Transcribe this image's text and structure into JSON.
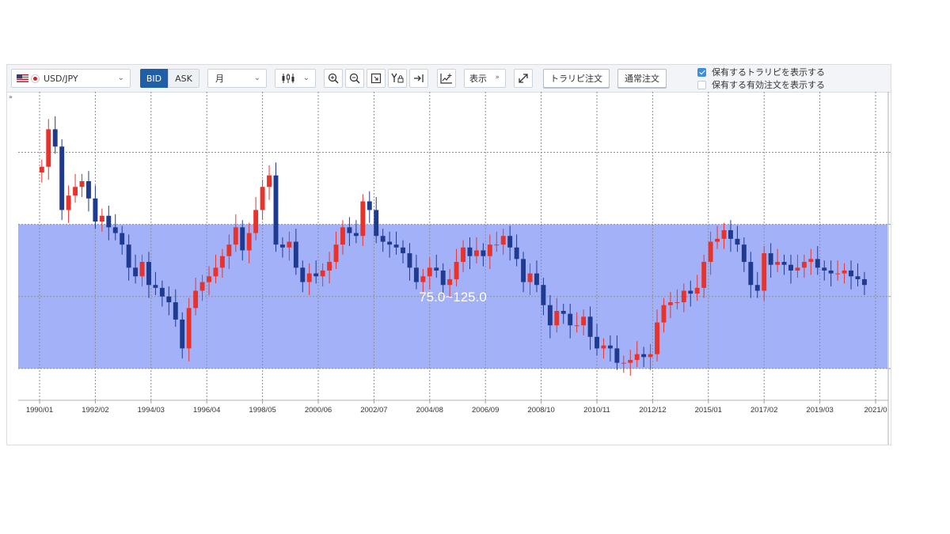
{
  "toolbar": {
    "symbol": "USD/JPY",
    "bid_label": "BID",
    "ask_label": "ASK",
    "period": "月",
    "display_label": "表示",
    "trailing_order_label": "トラリピ注文",
    "normal_order_label": "通常注文",
    "icons": [
      "chart-type-icon",
      "zoom-in-icon",
      "zoom-out-icon",
      "fit-icon",
      "y-lock-icon",
      "scroll-end-icon",
      "add-indicator-icon",
      "fullscreen-icon"
    ],
    "show_trailing_label": "保有するトラリピを表示する",
    "show_trailing_checked": true,
    "show_orders_label": "保有する有効注文を表示する",
    "show_orders_checked": false
  },
  "chart_data": {
    "type": "candlestick",
    "range_label": "75.0~125.0",
    "range": [
      75.0,
      125.0
    ],
    "range_color": "#a3b2f8",
    "up_color": "#e8332d",
    "down_color": "#1f3b8f",
    "ylim": [
      64,
      171
    ],
    "y_ticks": [
      "150.000",
      "125.000",
      "100.000",
      "75.000"
    ],
    "x_ticks": [
      "1990/01",
      "1992/02",
      "1994/03",
      "1996/04",
      "1998/05",
      "2000/06",
      "2002/07",
      "2004/08",
      "2006/09",
      "2008/10",
      "2010/11",
      "2012/12",
      "2015/01",
      "2017/02",
      "2019/03",
      "2021/0"
    ],
    "grid": true,
    "x": [
      "1990/01",
      "1990/04",
      "1990/07",
      "1990/10",
      "1991/01",
      "1991/04",
      "1991/07",
      "1991/10",
      "1992/01",
      "1992/04",
      "1992/07",
      "1992/10",
      "1993/01",
      "1993/04",
      "1993/07",
      "1993/10",
      "1994/01",
      "1994/04",
      "1994/07",
      "1994/10",
      "1995/01",
      "1995/04",
      "1995/07",
      "1995/10",
      "1996/01",
      "1996/04",
      "1996/07",
      "1996/10",
      "1997/01",
      "1997/04",
      "1997/07",
      "1997/10",
      "1998/01",
      "1998/04",
      "1998/07",
      "1998/10",
      "1999/01",
      "1999/04",
      "1999/07",
      "1999/10",
      "2000/01",
      "2000/04",
      "2000/07",
      "2000/10",
      "2001/01",
      "2001/04",
      "2001/07",
      "2001/10",
      "2002/01",
      "2002/04",
      "2002/07",
      "2002/10",
      "2003/01",
      "2003/04",
      "2003/07",
      "2003/10",
      "2004/01",
      "2004/04",
      "2004/07",
      "2004/10",
      "2005/01",
      "2005/04",
      "2005/07",
      "2005/10",
      "2006/01",
      "2006/04",
      "2006/07",
      "2006/10",
      "2007/01",
      "2007/04",
      "2007/07",
      "2007/10",
      "2008/01",
      "2008/04",
      "2008/07",
      "2008/10",
      "2009/01",
      "2009/04",
      "2009/07",
      "2009/10",
      "2010/01",
      "2010/04",
      "2010/07",
      "2010/10",
      "2011/01",
      "2011/04",
      "2011/07",
      "2011/10",
      "2012/01",
      "2012/04",
      "2012/07",
      "2012/10",
      "2013/01",
      "2013/04",
      "2013/07",
      "2013/10",
      "2014/01",
      "2014/04",
      "2014/07",
      "2014/10",
      "2015/01",
      "2015/04",
      "2015/07",
      "2015/10",
      "2016/01",
      "2016/04",
      "2016/07",
      "2016/10",
      "2017/01",
      "2017/04",
      "2017/07",
      "2017/10",
      "2018/01",
      "2018/04",
      "2018/07",
      "2018/10",
      "2019/01",
      "2019/04",
      "2019/07",
      "2019/10",
      "2020/01",
      "2020/04",
      "2020/07",
      "2020/10"
    ],
    "close": [
      145,
      158,
      152,
      130,
      135,
      138,
      140,
      134,
      126,
      128,
      124,
      122,
      118,
      110,
      107,
      112,
      104,
      103,
      100,
      98,
      92,
      82,
      96,
      102,
      105,
      107,
      110,
      114,
      118,
      124,
      116,
      122,
      130,
      138,
      142,
      118,
      117,
      119,
      110,
      105,
      108,
      107,
      109,
      112,
      118,
      124,
      122,
      121,
      133,
      130,
      121,
      119,
      118,
      117,
      115,
      110,
      105,
      107,
      110,
      109,
      104,
      106,
      112,
      117,
      114,
      116,
      114,
      118,
      118,
      121,
      117,
      113,
      105,
      108,
      104,
      97,
      90,
      95,
      94,
      90,
      90,
      93,
      86,
      82,
      83,
      82,
      77,
      77,
      78,
      80,
      79,
      80,
      91,
      97,
      98,
      98,
      102,
      101,
      103,
      112,
      119,
      120,
      123,
      120,
      118,
      112,
      104,
      102,
      115,
      111,
      112,
      111,
      109,
      110,
      112,
      113,
      110,
      109,
      108,
      108,
      109,
      107,
      106,
      104
    ]
  }
}
